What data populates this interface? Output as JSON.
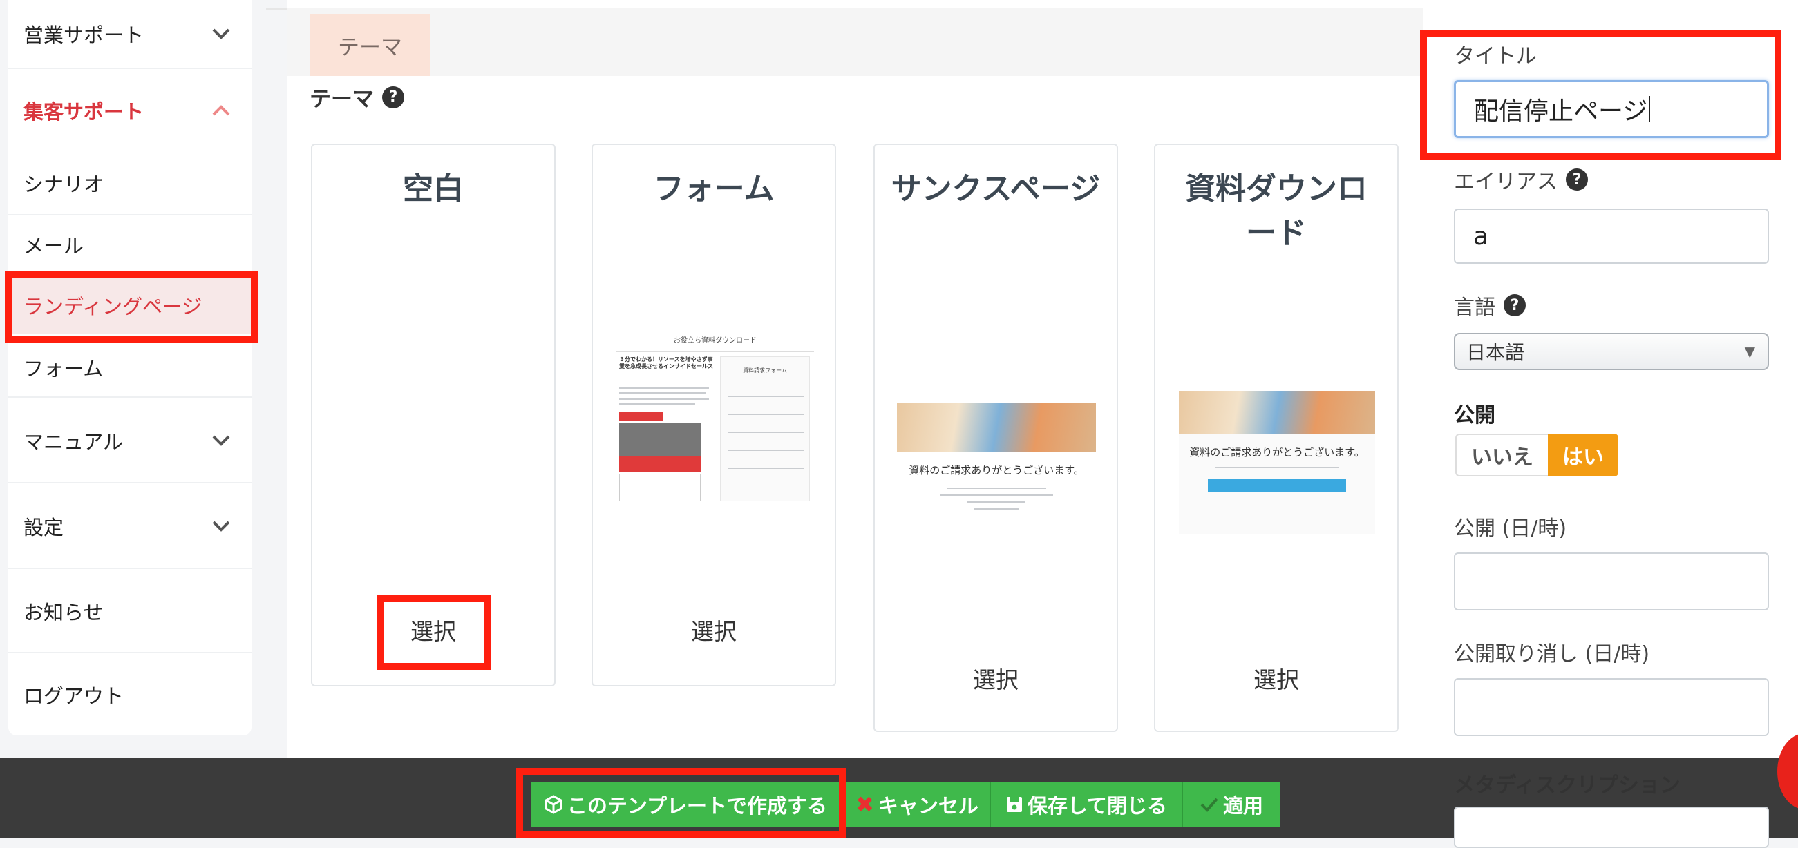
{
  "sidebar": {
    "items": [
      {
        "label": "営業サポート"
      },
      {
        "label": "集客サポート"
      },
      {
        "label": "シナリオ"
      },
      {
        "label": "メール"
      },
      {
        "label": "ランディングページ"
      },
      {
        "label": "フォーム"
      },
      {
        "label": "マニュアル"
      },
      {
        "label": "設定"
      },
      {
        "label": "お知らせ"
      },
      {
        "label": "ログアウト"
      }
    ]
  },
  "main": {
    "tab_label": "テーマ",
    "section_label": "テーマ",
    "cards": [
      {
        "title": "空白",
        "select_label": "選択"
      },
      {
        "title": "フォーム",
        "select_label": "選択"
      },
      {
        "title": "サンクスページ",
        "select_label": "選択"
      },
      {
        "title": "資料ダウンロード",
        "select_label": "選択"
      }
    ],
    "thumbnails": {
      "form_heading": "お役立ち資料ダウンロード",
      "form_panel_title": "資料請求フォーム",
      "form_lead": "３分でわかる！リソースを増やさず事業を急成長させるインサイドセールス",
      "thanks_message": "資料のご請求ありがとうございます。",
      "download_message": "資料のご請求ありがとうございます。"
    }
  },
  "right_panel": {
    "title_label": "タイトル",
    "title_value": "配信停止ページ",
    "alias_label": "エイリアス",
    "alias_value": "a",
    "language_label": "言語",
    "language_value": "日本語",
    "publish_label": "公開",
    "publish_no": "いいえ",
    "publish_yes": "はい",
    "publish_date_label": "公開 (日/時)",
    "unpublish_date_label": "公開取り消し (日/時)",
    "meta_description_label": "メタディスクリプション"
  },
  "footer": {
    "create_label": "このテンプレートで作成する",
    "cancel_label": "キャンセル",
    "save_close_label": "保存して閉じる",
    "apply_label": "適用"
  },
  "colors": {
    "accent_red": "#d9363e",
    "button_green": "#3fb94b",
    "toggle_yes": "#f39c12",
    "highlight_box": "#ff1f0f"
  }
}
